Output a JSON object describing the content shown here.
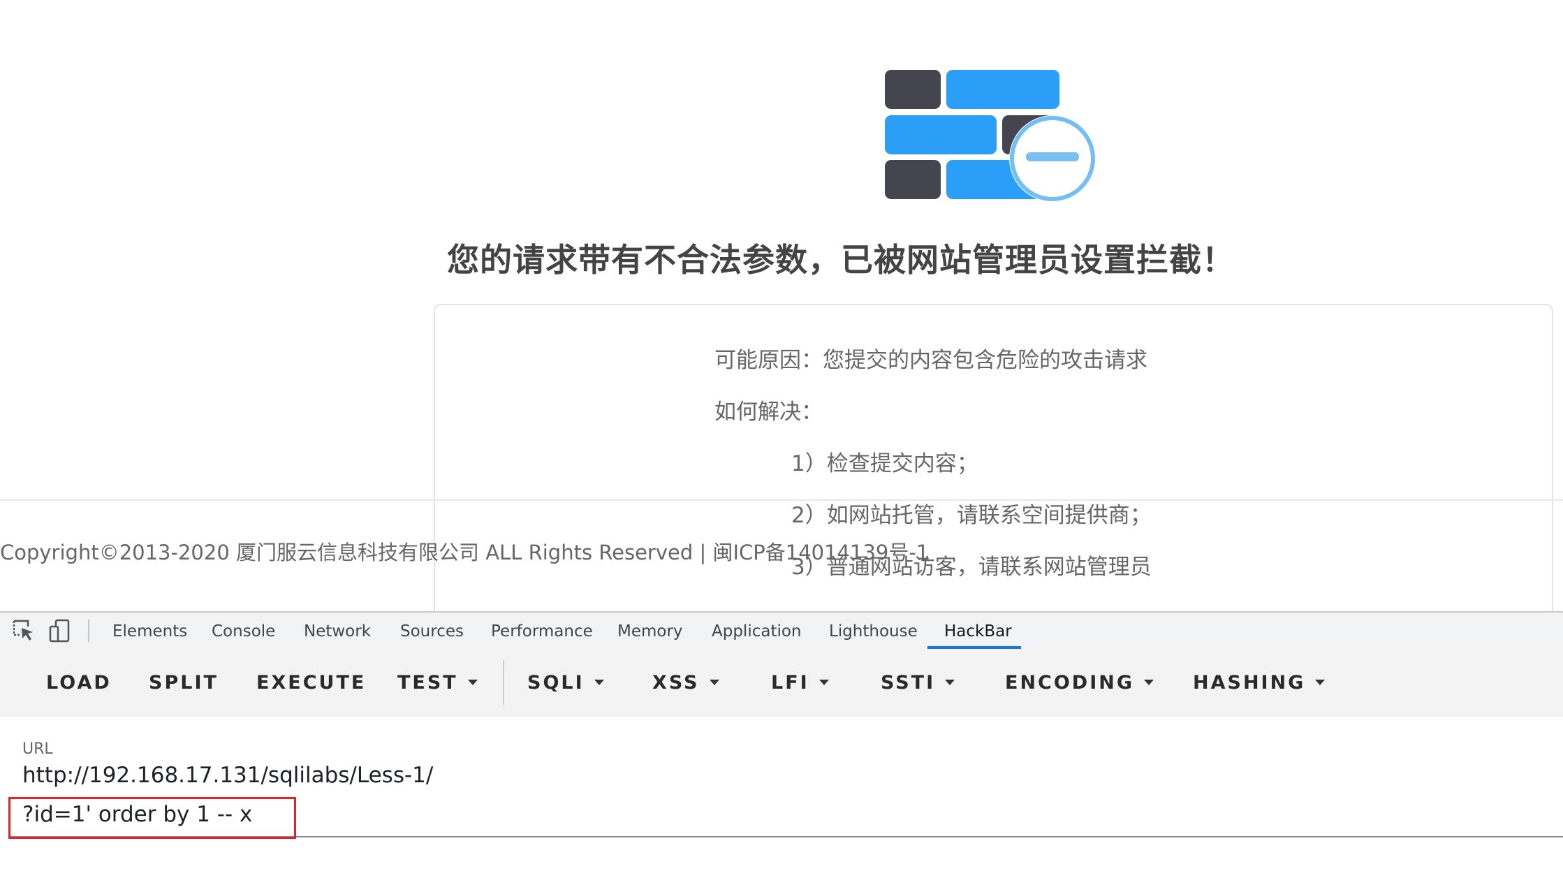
{
  "blocked_page": {
    "title": "您的请求带有不合法参数，已被网站管理员设置拦截！",
    "reason": "可能原因：您提交的内容包含危险的攻击请求",
    "how_to_fix": "如何解决：",
    "steps": [
      "1）检查提交内容；",
      "2）如网站托管，请联系空间提供商；",
      "3）普通网站访客，请联系网站管理员"
    ],
    "copyright": "Copyright©2013-2020 厦门服云信息科技有限公司 ALL Rights Reserved | 闽ICP备14014139号-1",
    "colors": {
      "brick_dark": "#45454f",
      "brick_blue": "#2b9ef8",
      "badge_ring": "#74bdf5",
      "badge_bar": "#7bbef0"
    }
  },
  "devtools": {
    "icons": [
      "inspect-element-icon",
      "device-toolbar-icon"
    ],
    "tabs": [
      {
        "label": "Elements"
      },
      {
        "label": "Console"
      },
      {
        "label": "Network"
      },
      {
        "label": "Sources"
      },
      {
        "label": "Performance"
      },
      {
        "label": "Memory"
      },
      {
        "label": "Application"
      },
      {
        "label": "Lighthouse"
      },
      {
        "label": "HackBar",
        "active": true
      }
    ],
    "accent": "#1a73e8"
  },
  "hackbar": {
    "buttons": [
      {
        "label": "LOAD",
        "dropdown": false
      },
      {
        "label": "SPLIT",
        "dropdown": false
      },
      {
        "label": "EXECUTE",
        "dropdown": false
      },
      {
        "label": "TEST",
        "dropdown": true
      },
      {
        "label": "SQLI",
        "dropdown": true
      },
      {
        "label": "XSS",
        "dropdown": true
      },
      {
        "label": "LFI",
        "dropdown": true
      },
      {
        "label": "SSTI",
        "dropdown": true
      },
      {
        "label": "ENCODING",
        "dropdown": true
      },
      {
        "label": "HASHING",
        "dropdown": true
      }
    ],
    "url_label": "URL",
    "url_lines": [
      "http://192.168.17.131/sqlilabs/Less-1/",
      "?id=1' order by 1 -- x"
    ],
    "highlight_color": "#e02424"
  }
}
